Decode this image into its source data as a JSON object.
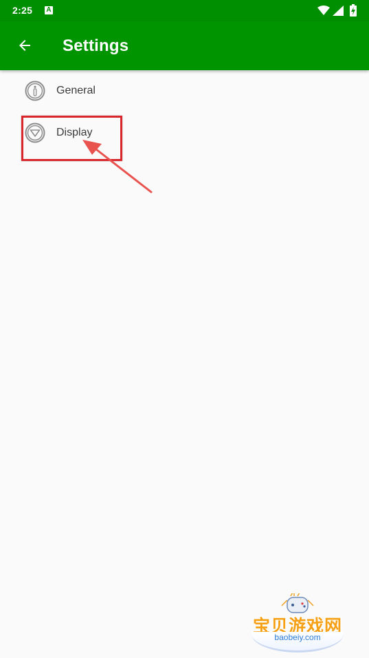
{
  "status_bar": {
    "time": "2:25",
    "notification_icon": "a-letter-icon",
    "notification_letter": "A",
    "icons": [
      "wifi-icon",
      "signal-icon",
      "battery-charging-icon"
    ]
  },
  "app_bar": {
    "title": "Settings",
    "back_icon": "arrow-left-icon",
    "background_color": "#009400"
  },
  "settings": {
    "items": [
      {
        "label": "General",
        "icon": "info-circle-icon"
      },
      {
        "label": "Display",
        "icon": "triangle-down-circle-icon"
      }
    ]
  },
  "annotation": {
    "highlight_color": "#d9262c",
    "target": "Display"
  },
  "watermark": {
    "text": "宝贝游戏网",
    "url": "baobeiy.com"
  }
}
